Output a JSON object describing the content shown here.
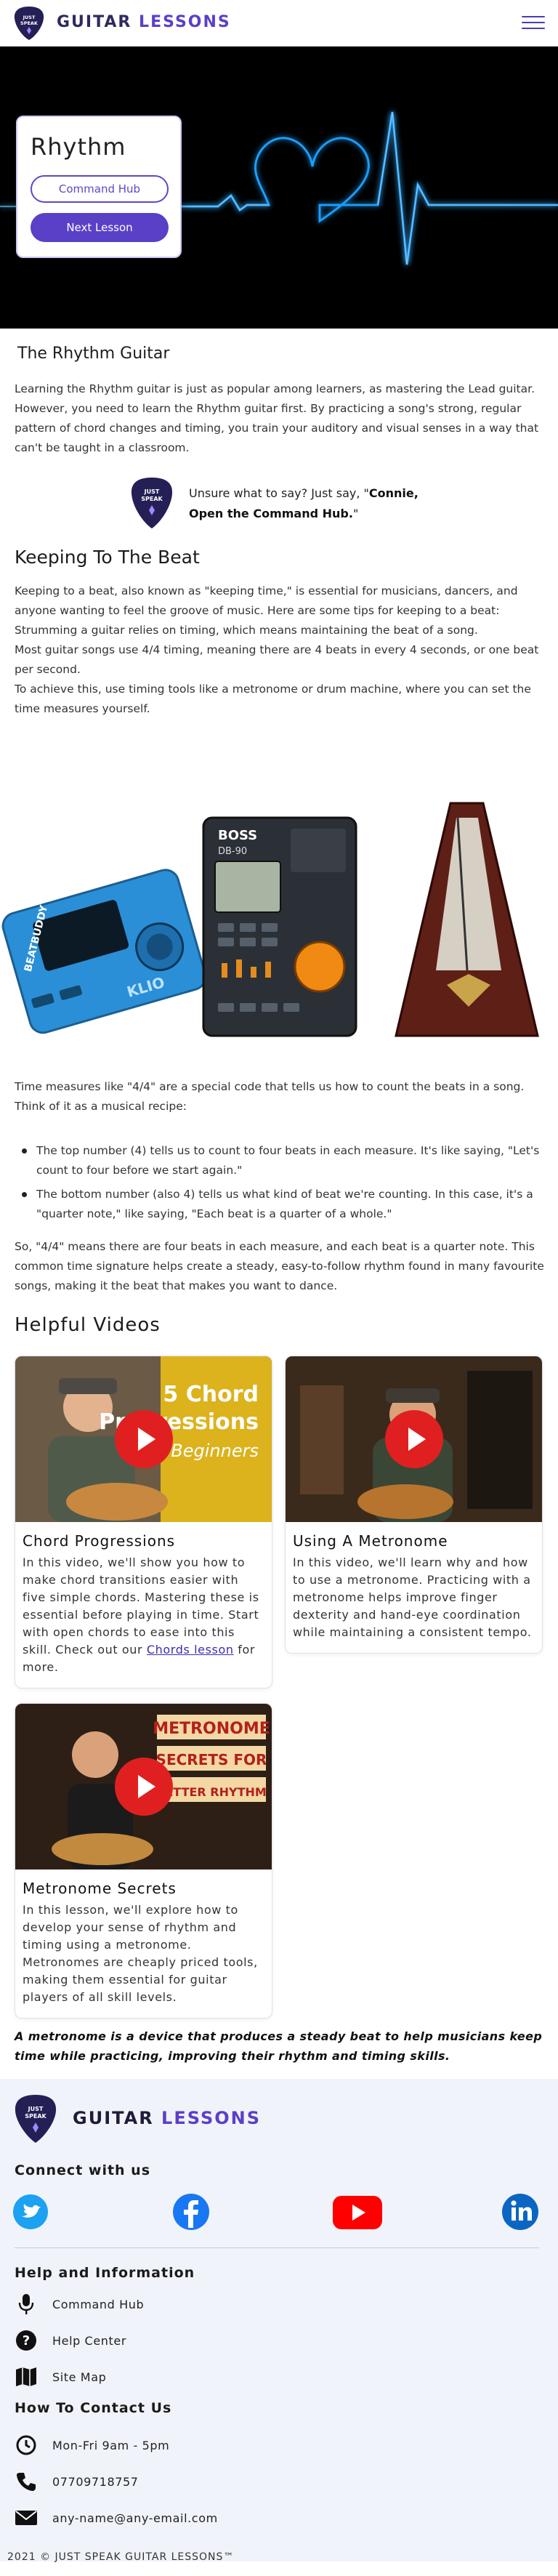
{
  "header": {
    "brand_part1": "GUITAR",
    "brand_part2": "LESSONS",
    "logo_text_line1": "JUST",
    "logo_text_line2": "SPEAK",
    "menu_icon": "hamburger-menu-icon"
  },
  "hero": {
    "title": "Rhythm",
    "primary_button": "Command Hub",
    "secondary_button": "Next Lesson"
  },
  "section_rhythm": {
    "heading": "The Rhythm Guitar",
    "paragraph": "Learning the Rhythm guitar is just as popular among learners, as mastering the Lead guitar. However, you need to learn the Rhythm guitar first. By practicing a song's strong, regular pattern of chord changes and timing, you train your auditory and visual senses in a way that can't be taught in a classroom."
  },
  "callout": {
    "text_plain": "Unsure what to say? Just say, \"",
    "text_bold_1": "Connie,",
    "text_bold_2": "Open the Command Hub.",
    "text_end": "\""
  },
  "section_beat": {
    "heading": "Keeping To The Beat",
    "p1": "Keeping to a beat, also known as \"keeping time,\" is essential for musicians, dancers, and anyone wanting to feel the groove of music. Here are some tips for keeping to a beat:",
    "p2": "Strumming a guitar relies on timing, which means maintaining the beat of a song.",
    "p3": "Most guitar songs use 4/4 timing, meaning there are 4 beats in every 4 seconds, or one beat per second.",
    "p4": "To achieve this, use timing tools like a metronome or drum machine, where you can set the time measures yourself."
  },
  "devices": {
    "drum_machine_label": "BEATBUDDY",
    "drum_machine_brand": "KLIO",
    "boss_brand": "BOSS",
    "boss_model": "DB-90"
  },
  "section_measures": {
    "intro": "Time measures like \"4/4\" are a special code that tells us how to count the beats in a song. Think of it as a musical recipe:",
    "bullets": [
      "The top number (4) tells us to count to four beats in each measure. It's like saying, \"Let's count to four before we start again.\"",
      "The bottom number (also 4) tells us what kind of beat we're counting. In this case, it's a \"quarter note,\" like saying, \"Each beat is a quarter of a whole.\""
    ],
    "outro": "So, \"4/4\" means there are four beats in each measure, and each beat is a quarter note. This common time signature helps create a steady, easy-to-follow rhythm found in many favourite songs, making it the beat that makes you want to dance."
  },
  "videos": {
    "heading": "Helpful Videos",
    "items": [
      {
        "title": "Chord Progressions",
        "thumb_line1": "5 Chord",
        "thumb_line2": "Progressions",
        "thumb_line3": "for Beginners",
        "desc": "In this video, we'll show you how to make chord transitions easier with five simple chords. Mastering these is essential before playing in time. Start with open chords to ease into this skill. Check out our ",
        "link": "Chords lesson",
        "desc_end": " for more."
      },
      {
        "title": "Using A Metronome",
        "desc": "In this video, we'll learn why and how to use a metronome. Practicing with a metronome helps improve finger dexterity and hand-eye coordination while maintaining a consistent tempo."
      },
      {
        "title": "Metronome Secrets",
        "thumb_line1": "METRONOME",
        "thumb_line2": "SECRETS FOR",
        "thumb_line3": "BETTER RHYTHM",
        "desc": "In this lesson, we'll explore how to develop your sense of rhythm and timing using a metronome. Metronomes are cheaply priced tools, making them essential for guitar players of all skill levels."
      }
    ]
  },
  "quote": "A metronome is a device that produces a steady beat to help musicians keep time while practicing, improving their rhythm and timing skills.",
  "footer": {
    "brand_part1": "GUITAR",
    "brand_part2": "LESSONS",
    "connect_heading": "Connect with us",
    "social": [
      "twitter-icon",
      "facebook-icon",
      "youtube-icon",
      "linkedin-icon"
    ],
    "help_heading": "Help and Information",
    "help_items": [
      "Command Hub",
      "Help Center",
      "Site Map"
    ],
    "contact_heading": "How To Contact Us",
    "contact_items": [
      "Mon-Fri 9am - 5pm",
      "07709718757",
      "any-name@any-email.com"
    ],
    "copyright": "2021 © JUST SPEAK GUITAR LESSONS™"
  },
  "colors": {
    "brand_purple": "#5940c6",
    "brand_navy": "#2e2a5e",
    "play_red": "#e02020",
    "footer_bg": "#f1f3fb",
    "pulse_blue": "#1ea0ff"
  }
}
